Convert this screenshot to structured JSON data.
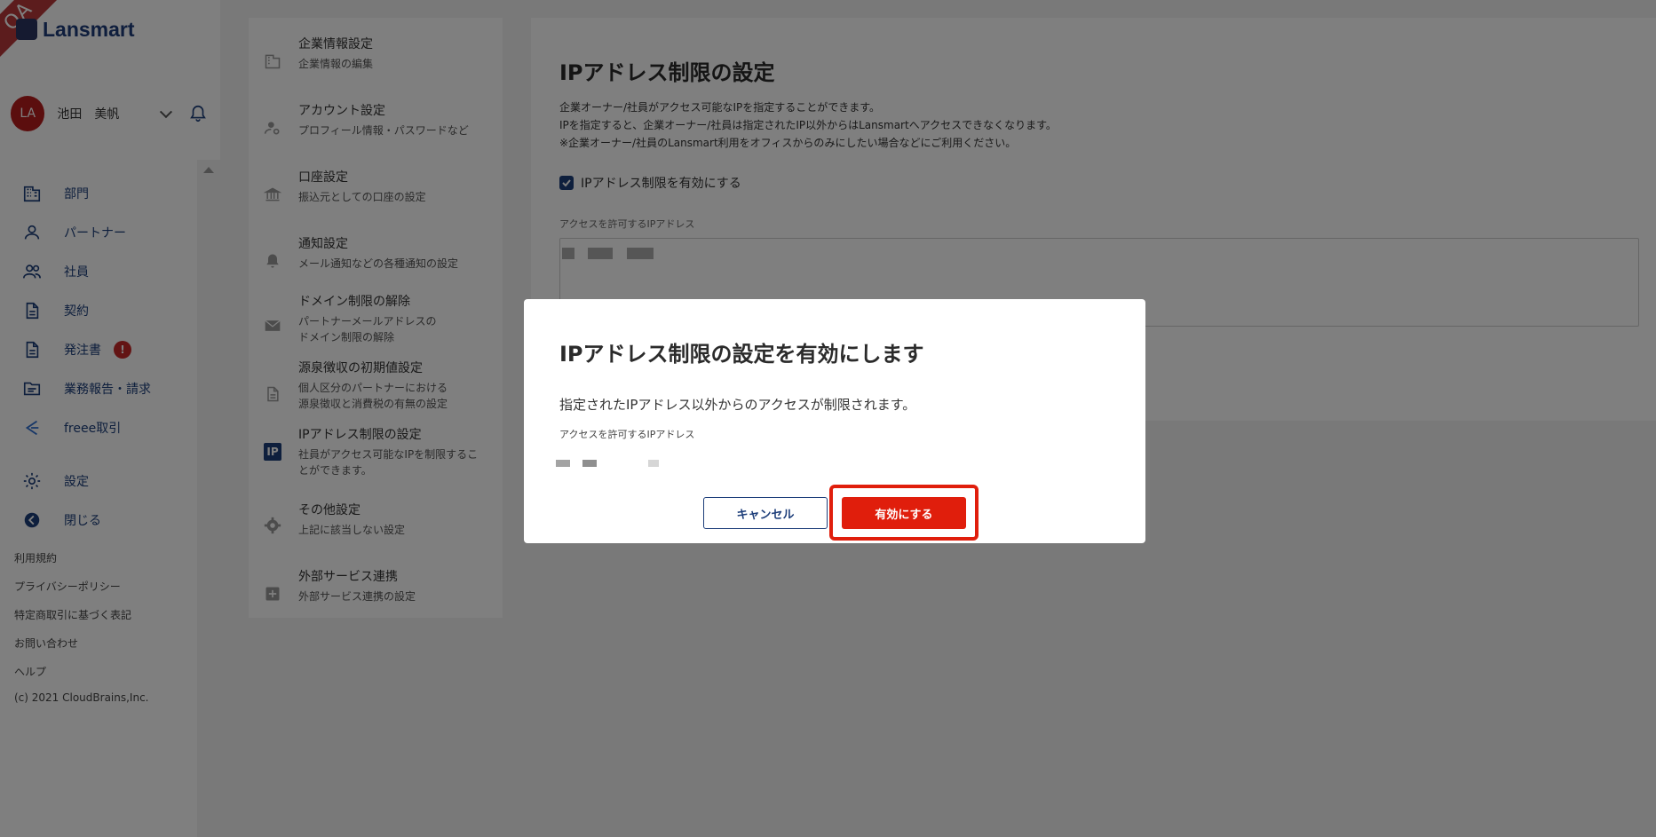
{
  "app": {
    "logo_text": "Lansmart",
    "qa_ribbon": "QA"
  },
  "user": {
    "initials": "LA",
    "name": "池田　美帆"
  },
  "nav": {
    "items": [
      {
        "label": "部門",
        "icon": "building-icon"
      },
      {
        "label": "パートナー",
        "icon": "person-icon"
      },
      {
        "label": "社員",
        "icon": "people-icon"
      },
      {
        "label": "契約",
        "icon": "document-icon"
      },
      {
        "label": "発注書",
        "icon": "document-icon",
        "badge": "!"
      },
      {
        "label": "業務報告・請求",
        "icon": "folder-icon"
      },
      {
        "label": "freee取引",
        "icon": "freee-icon"
      }
    ],
    "settings_label": "設定",
    "close_label": "閉じる"
  },
  "footer": {
    "links": [
      "利用規約",
      "プライバシーポリシー",
      "特定商取引に基づく表記",
      "お問い合わせ",
      "ヘルプ"
    ],
    "copyright": "(c) 2021 CloudBrains,Inc."
  },
  "settings_menu": [
    {
      "title": "企業情報設定",
      "sub": [
        "企業情報の編集"
      ],
      "icon": "building-icon"
    },
    {
      "title": "アカウント設定",
      "sub": [
        "プロフィール情報・パスワードなど"
      ],
      "icon": "account-gear-icon"
    },
    {
      "title": "口座設定",
      "sub": [
        "振込元としての口座の設定"
      ],
      "icon": "bank-icon"
    },
    {
      "title": "通知設定",
      "sub": [
        "メール通知などの各種通知の設定"
      ],
      "icon": "bell-icon"
    },
    {
      "title": "ドメイン制限の解除",
      "sub": [
        "パートナーメールアドレスの",
        "ドメイン制限の解除"
      ],
      "icon": "mail-icon"
    },
    {
      "title": "源泉徴収の初期値設定",
      "sub": [
        "個人区分のパートナーにおける",
        "源泉徴収と消費税の有無の設定"
      ],
      "icon": "document-icon"
    },
    {
      "title": "IPアドレス制限の設定",
      "sub": [
        "社員がアクセス可能なIPを制限するこ",
        "とができます。"
      ],
      "icon": "ip-icon",
      "icon_text": "IP"
    },
    {
      "title": "その他設定",
      "sub": [
        "上記に該当しない設定"
      ],
      "icon": "gear-icon"
    },
    {
      "title": "外部サービス連携",
      "sub": [
        "外部サービス連携の設定"
      ],
      "icon": "plus-box-icon"
    }
  ],
  "main": {
    "title": "IPアドレス制限の設定",
    "desc": [
      "企業オーナー/社員がアクセス可能なIPを指定することができます。",
      "IPを指定すると、企業オーナー/社員は指定されたIP以外からはLansmartへアクセスできなくなります。",
      "※企業オーナー/社員のLansmart利用をオフィスからのみにしたい場合などにご利用ください。"
    ],
    "checkbox_label": "IPアドレス制限を有効にする",
    "checkbox_checked": true,
    "ip_field_label": "アクセスを許可するIPアドレス"
  },
  "dialog": {
    "title": "IPアドレス制限の設定を有効にします",
    "message": "指定されたIPアドレス以外からのアクセスが制限されます。",
    "ip_label": "アクセスを許可するIPアドレス",
    "cancel_label": "キャンセル",
    "confirm_label": "有効にする"
  },
  "colors": {
    "brand": "#1d3e7a",
    "danger": "#e01e0c",
    "alert": "#c62828"
  }
}
